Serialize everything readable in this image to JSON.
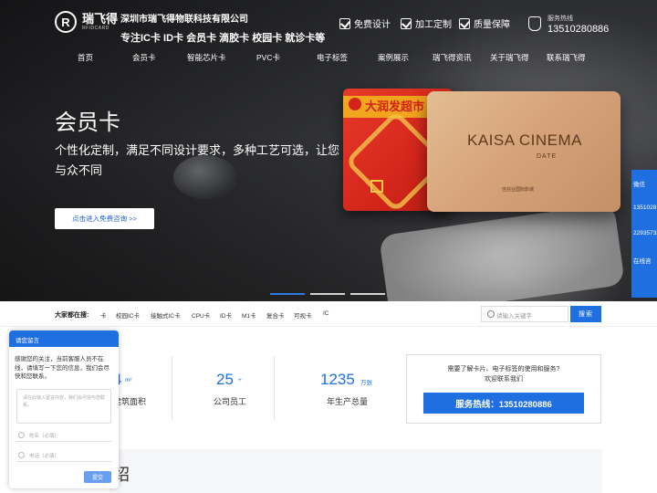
{
  "logo": {
    "name": "瑞飞得",
    "sub": "RFIDCARD"
  },
  "company": {
    "name": "深圳市瑞飞得物联科技有限公司",
    "tagline": "专注IC卡 ID卡 会员卡 滴胶卡 校园卡 就诊卡等"
  },
  "features": [
    "免费设计",
    "加工定制",
    "质量保障"
  ],
  "hotline": {
    "label": "服务热线",
    "number": "13510280886"
  },
  "nav": [
    "首页",
    "会员卡",
    "智能芯片卡",
    "PVC卡",
    "电子标签",
    "案例展示",
    "瑞飞得资讯",
    "关于瑞飞得",
    "联系瑞飞得"
  ],
  "hero": {
    "title": "会员卡",
    "subtitle": "个性化定制，满足不同设计要求，多种工艺可选，让您与众不同",
    "button": "点击进入免费咨询 >>",
    "card_red_title": "大润发超市",
    "card_gold_title": "KAISA CINEMA",
    "card_gold_sub": "DATE",
    "card_gold_foot": "佳兆业国际影城"
  },
  "right_float": [
    "微信",
    "1351028",
    "22935733",
    "在线咨"
  ],
  "search": {
    "label": "大家都在搜:",
    "keywords": [
      "卡",
      "校园IC卡",
      "接触式IC卡",
      "CPU卡",
      "ID卡",
      "M1卡",
      "复合卡",
      "可视卡",
      "IC"
    ],
    "placeholder": "请输入关键字",
    "button": "搜索"
  },
  "stats": [
    {
      "num": "4",
      "unit": "m²",
      "label": "建筑面积"
    },
    {
      "num": "25",
      "unit": "+",
      "label": "公司员工"
    },
    {
      "num": "1235",
      "unit": "万张",
      "label": "年生产总量"
    }
  ],
  "service": {
    "line1": "需要了解卡片、电子标签的使用和服务?",
    "line2": "欢迎联系我们",
    "button": "服务热线：13510280886"
  },
  "section_title_partial": "绍",
  "chat": {
    "header": "请您留言",
    "message": "感谢您的关注，当前客服人员不在线，请填写一下您的信息，我们会尽快和您联系。",
    "textarea_placeholder": "请在此输入留言内容，我们会尽快与您联系。",
    "name_placeholder": "姓名（必填）",
    "phone_placeholder": "电话（必填）",
    "submit": "提交"
  },
  "colors": {
    "accent": "#1f6fe0"
  }
}
